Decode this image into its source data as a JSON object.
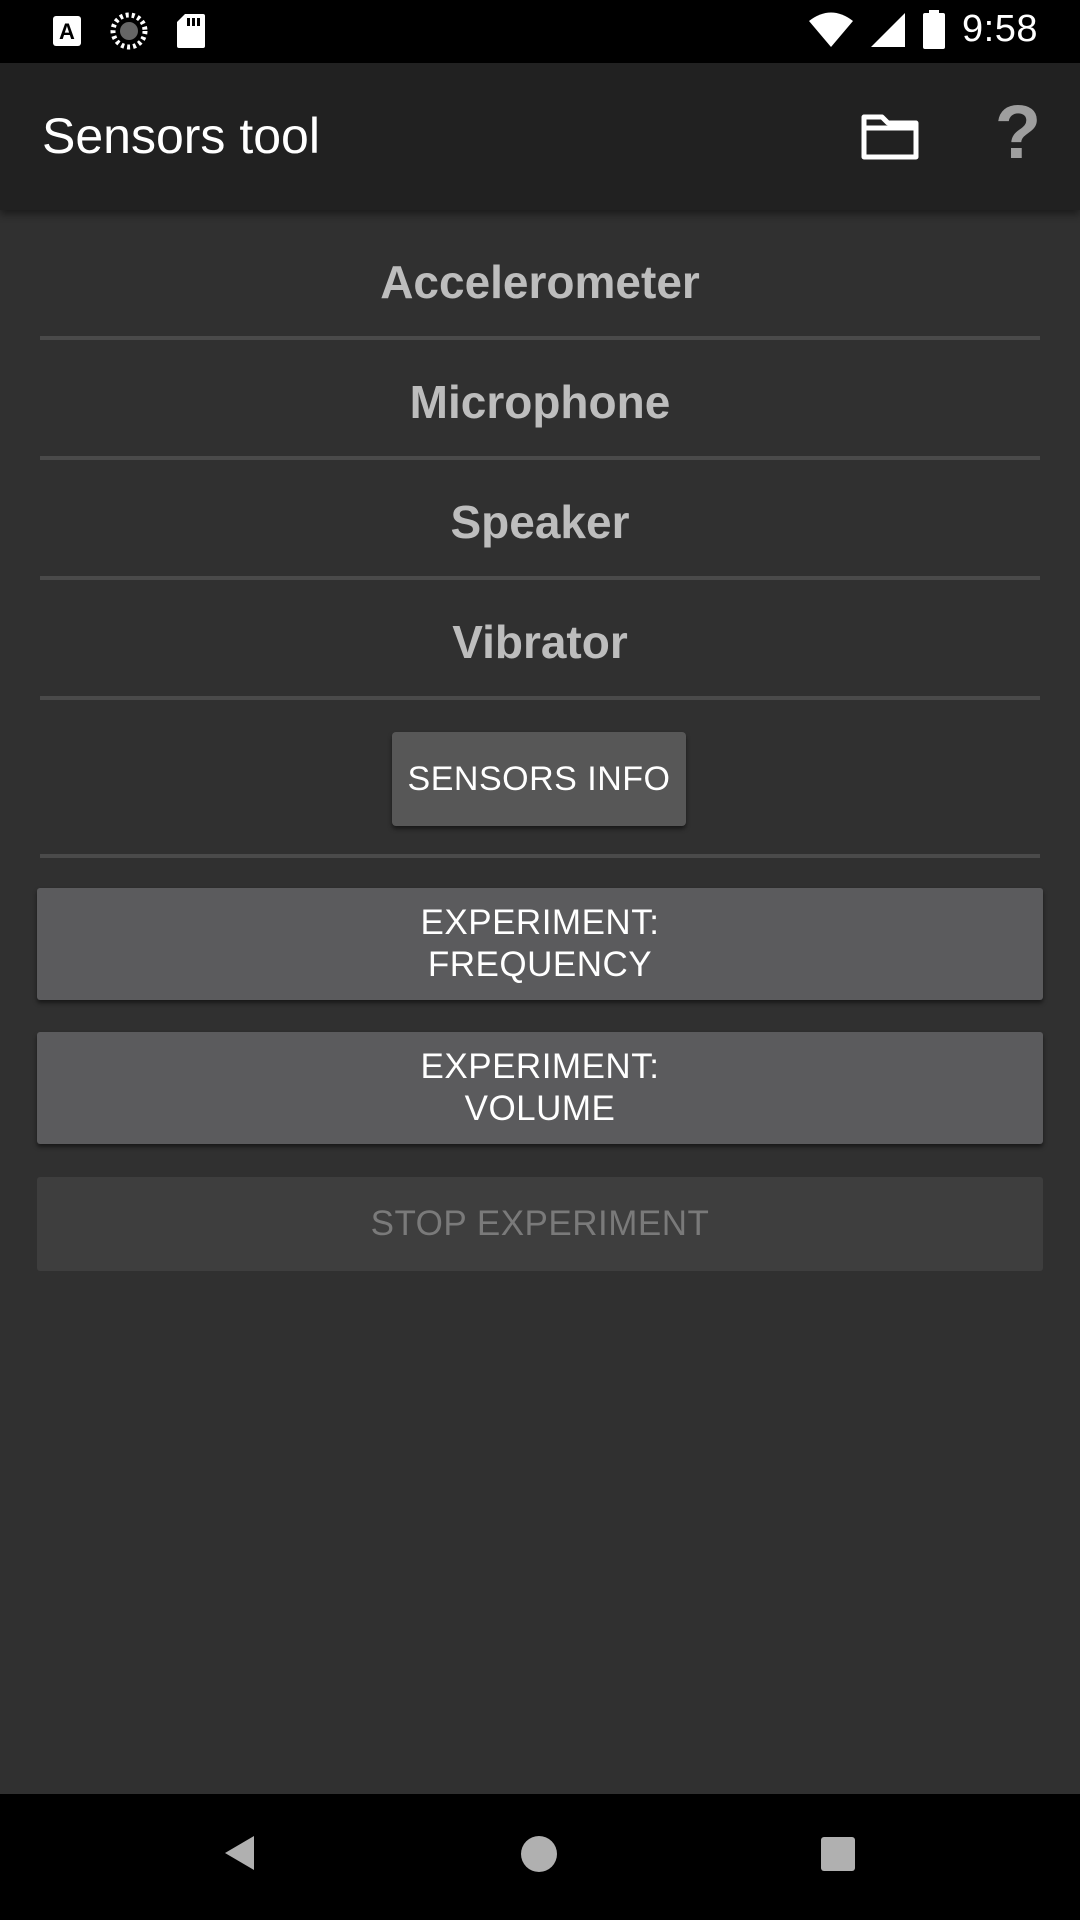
{
  "status_bar": {
    "time": "9:58",
    "left_icons": [
      "a-notification-icon",
      "loading-icon",
      "sd-card-icon"
    ],
    "right_icons": [
      "wifi-icon",
      "signal-icon",
      "battery-icon"
    ]
  },
  "app_bar": {
    "title": "Sensors tool",
    "actions": [
      {
        "name": "folder-icon"
      },
      {
        "name": "help-icon",
        "glyph": "?"
      }
    ]
  },
  "sensors": [
    {
      "label": "Accelerometer"
    },
    {
      "label": "Microphone"
    },
    {
      "label": "Speaker"
    },
    {
      "label": "Vibrator"
    }
  ],
  "buttons": {
    "sensors_info": "SENSORS INFO",
    "experiment_frequency": {
      "line1": "EXPERIMENT:",
      "line2": "FREQUENCY"
    },
    "experiment_volume": {
      "line1": "EXPERIMENT:",
      "line2": "VOLUME"
    },
    "stop_experiment": "STOP EXPERIMENT",
    "stop_experiment_enabled": false
  },
  "nav_bar": [
    "back",
    "home",
    "recents"
  ],
  "colors": {
    "background": "#303030",
    "app_bar": "#212121",
    "button": "#5b5b5d",
    "disabled_button": "#3e3e3e",
    "sensor_text": "#bdbdbd"
  }
}
